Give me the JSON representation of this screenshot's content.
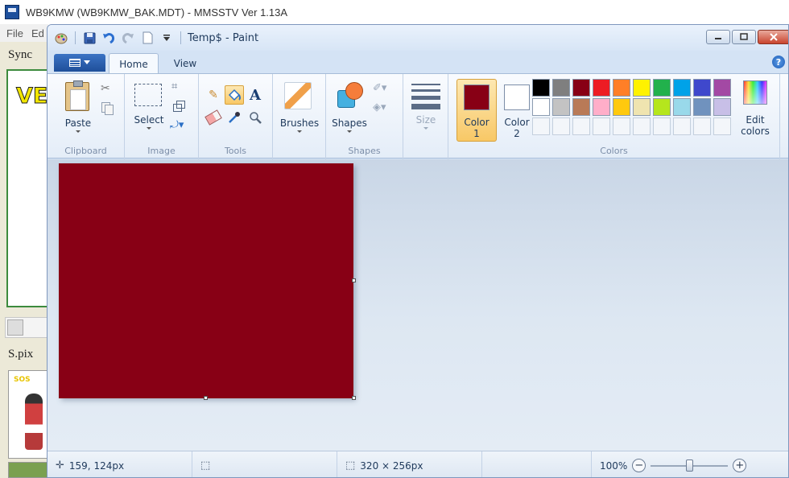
{
  "background_app": {
    "title": "WB9KMW (WB9KMW_BAK.MDT) - MMSSTV Ver 1.13A",
    "menu": [
      "File",
      "Ed"
    ],
    "sync_label": "Sync",
    "rx_text": "VE",
    "spix_label": "S.pix",
    "thumb_text": "SOS"
  },
  "paint": {
    "title": "Temp$ - Paint",
    "tabs": {
      "home": "Home",
      "view": "View"
    },
    "help_glyph": "?",
    "clipboard": {
      "paste": "Paste",
      "group": "Clipboard"
    },
    "image": {
      "select": "Select",
      "group": "Image"
    },
    "tools": {
      "text_glyph": "A",
      "group": "Tools"
    },
    "brushes": {
      "label": "Brushes"
    },
    "shapes": {
      "label": "Shapes",
      "group": "Shapes"
    },
    "size": {
      "label": "Size"
    },
    "colors": {
      "group": "Colors",
      "color1_label": "Color\n1",
      "color2_label": "Color\n2",
      "edit_label": "Edit\ncolors",
      "color1": "#880015",
      "color2": "#ffffff",
      "palette_row1": [
        "#000000",
        "#7f7f7f",
        "#880015",
        "#ed1c24",
        "#ff7f27",
        "#fff200",
        "#22b14c",
        "#00a2e8",
        "#3f48cc",
        "#a349a4"
      ],
      "palette_row2": [
        "#ffffff",
        "#c3c3c3",
        "#b97a57",
        "#ffaec9",
        "#ffc90e",
        "#efe4b0",
        "#b5e61d",
        "#99d9ea",
        "#7092be",
        "#c8bfe7"
      ]
    },
    "canvas": {
      "fill_color": "#880015"
    },
    "status": {
      "cursor": "159, 124px",
      "selection": "",
      "size": "320 × 256px",
      "filesize": "",
      "zoom": "100%",
      "zoom_fraction": 0.5
    }
  }
}
